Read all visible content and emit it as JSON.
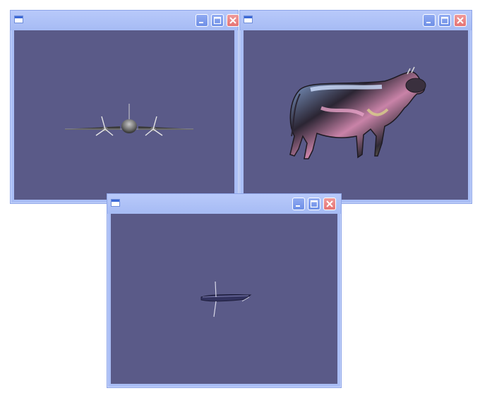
{
  "windows": [
    {
      "id": "airplane",
      "title": "",
      "scene_icon": "airplane-model-icon"
    },
    {
      "id": "cow",
      "title": "",
      "scene_icon": "cow-model-icon"
    },
    {
      "id": "jet",
      "title": "",
      "scene_icon": "jet-model-icon"
    }
  ],
  "colors": {
    "viewport_bg": "#5a5a88",
    "frame": "#a9bdf5",
    "button_blue": "#7b98ec",
    "button_close": "#e57373"
  },
  "icons": {
    "system": "window-system-icon",
    "minimize": "minimize-icon",
    "maximize": "maximize-icon",
    "close": "close-icon"
  }
}
